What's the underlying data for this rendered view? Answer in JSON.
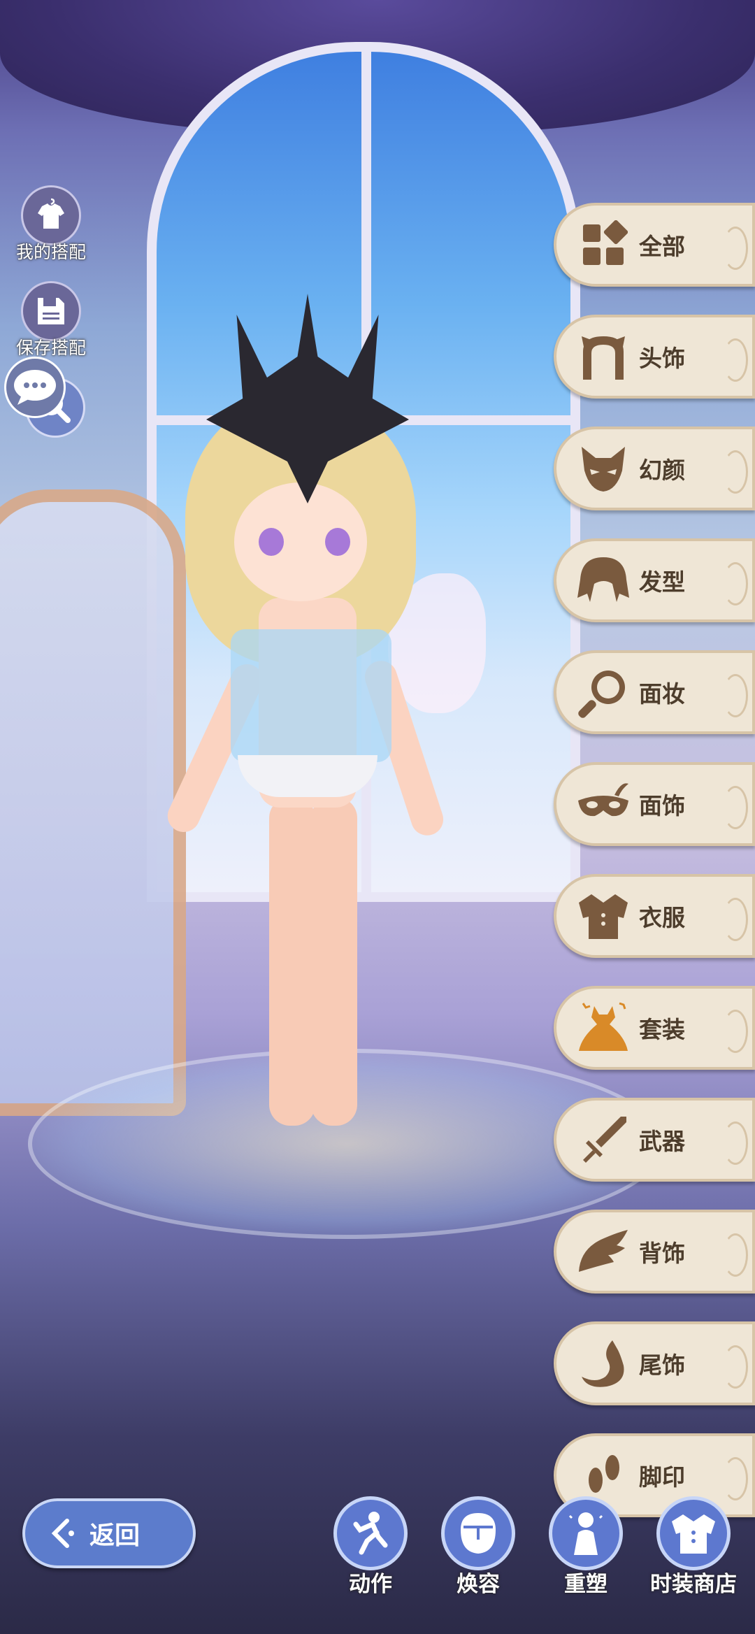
{
  "left_actions": {
    "my_outfits_label": "我的搭配",
    "save_outfit_label": "保存搭配"
  },
  "categories": [
    {
      "label": "全部",
      "icon": "grid-icon"
    },
    {
      "label": "头饰",
      "icon": "cat-ears-icon"
    },
    {
      "label": "幻颜",
      "icon": "fox-mask-icon"
    },
    {
      "label": "发型",
      "icon": "hair-icon"
    },
    {
      "label": "面妆",
      "icon": "hand-mirror-icon"
    },
    {
      "label": "面饰",
      "icon": "masquerade-mask-icon"
    },
    {
      "label": "衣服",
      "icon": "jacket-icon"
    },
    {
      "label": "套装",
      "icon": "dress-icon"
    },
    {
      "label": "武器",
      "icon": "sword-icon"
    },
    {
      "label": "背饰",
      "icon": "wing-icon"
    },
    {
      "label": "尾饰",
      "icon": "tail-icon"
    },
    {
      "label": "脚印",
      "icon": "footprint-icon"
    }
  ],
  "bottom_bar": {
    "back_label": "返回",
    "buttons": [
      {
        "label": "动作",
        "icon": "pose-icon"
      },
      {
        "label": "焕容",
        "icon": "face-icon"
      },
      {
        "label": "重塑",
        "icon": "body-reshape-icon"
      },
      {
        "label": "时装商店",
        "icon": "fashion-shop-icon"
      }
    ]
  },
  "colors": {
    "tab_bg": "#efe6d6",
    "tab_icon": "#7a5a3e",
    "selected_suit_icon": "#d98a28",
    "button_blue": "#5d78cf"
  }
}
